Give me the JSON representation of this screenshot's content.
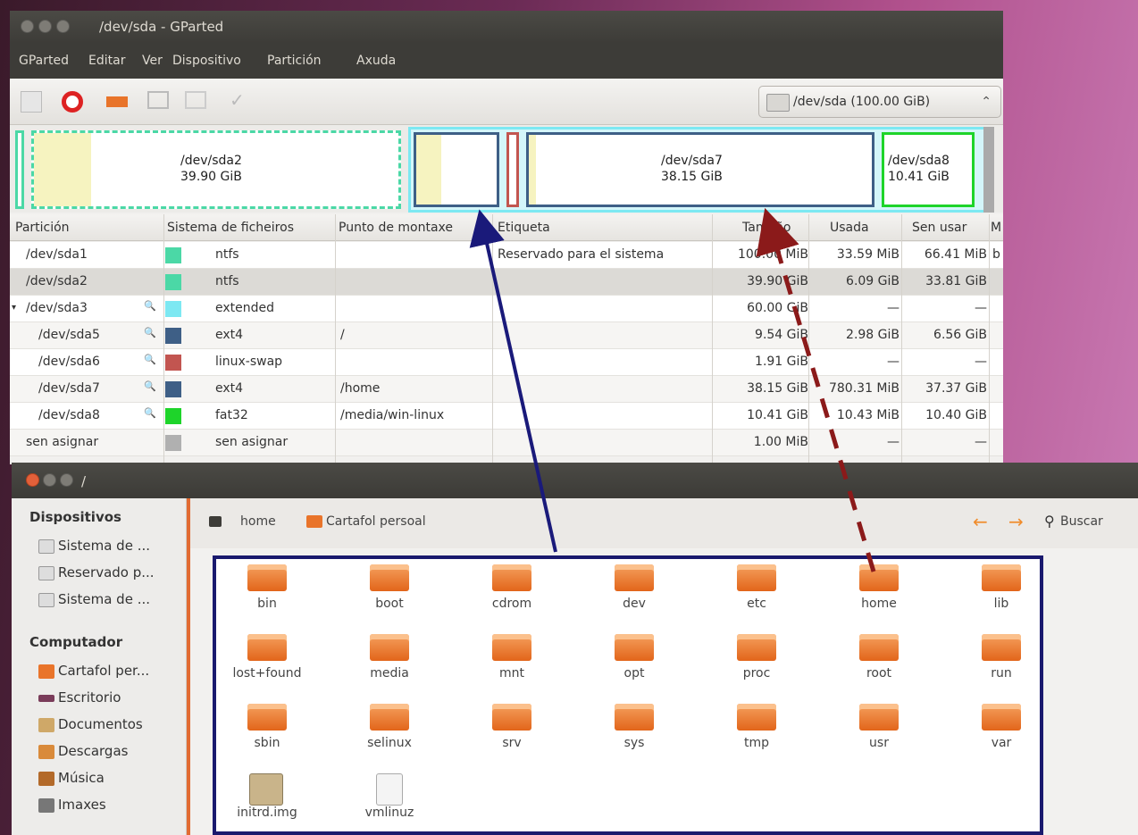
{
  "gparted": {
    "title": "/dev/sda - GParted",
    "menu": [
      "GParted",
      "Editar",
      "Ver",
      "Dispositivo",
      "Partición",
      "Axuda"
    ],
    "device_selector": "/dev/sda  (100.00 GiB)",
    "device_selector_arrow": "⌃",
    "diskmap": {
      "sda2": {
        "name": "/dev/sda2",
        "size": "39.90 GiB"
      },
      "sda7": {
        "name": "/dev/sda7",
        "size": "38.15 GiB"
      },
      "sda8": {
        "name": "/dev/sda8",
        "size": "10.41 GiB"
      }
    },
    "columns": [
      "Partición",
      "Sistema de ficheiros",
      "Punto de montaxe",
      "Etiqueta",
      "Tamaño",
      "Usada",
      "Sen usar",
      "M"
    ],
    "rows": [
      {
        "partition": "/dev/sda1",
        "fs": "ntfs",
        "color": "#4bd8a6",
        "mount": "",
        "label": "Reservado para el sistema",
        "size": "100.00 MiB",
        "used": "33.59 MiB",
        "unused": "66.41 MiB",
        "flag": "b"
      },
      {
        "partition": "/dev/sda2",
        "fs": "ntfs",
        "color": "#4bd8a6",
        "mount": "",
        "label": "",
        "size": "39.90 GiB",
        "used": "6.09 GiB",
        "unused": "33.81 GiB",
        "flag": ""
      },
      {
        "partition": "/dev/sda3",
        "fs": "extended",
        "color": "#7de8f2",
        "mount": "",
        "label": "",
        "size": "60.00 GiB",
        "used": "—",
        "unused": "—",
        "flag": ""
      },
      {
        "partition": "/dev/sda5",
        "fs": "ext4",
        "color": "#3e5f86",
        "mount": "/",
        "label": "",
        "size": "9.54 GiB",
        "used": "2.98 GiB",
        "unused": "6.56 GiB",
        "flag": ""
      },
      {
        "partition": "/dev/sda6",
        "fs": "linux-swap",
        "color": "#c25550",
        "mount": "",
        "label": "",
        "size": "1.91 GiB",
        "used": "—",
        "unused": "—",
        "flag": ""
      },
      {
        "partition": "/dev/sda7",
        "fs": "ext4",
        "color": "#3e5f86",
        "mount": "/home",
        "label": "",
        "size": "38.15 GiB",
        "used": "780.31 MiB",
        "unused": "37.37 GiB",
        "flag": ""
      },
      {
        "partition": "/dev/sda8",
        "fs": "fat32",
        "color": "#1ed42a",
        "mount": "/media/win-linux",
        "label": "",
        "size": "10.41 GiB",
        "used": "10.43 MiB",
        "unused": "10.40 GiB",
        "flag": ""
      },
      {
        "partition": "sen asignar",
        "fs": "sen asignar",
        "color": "#b0b0b0",
        "mount": "",
        "label": "",
        "size": "1.00 MiB",
        "used": "—",
        "unused": "—",
        "flag": ""
      }
    ]
  },
  "nautilus": {
    "title": "/",
    "sidebar": {
      "devices_header": "Dispositivos",
      "devices": [
        "Sistema de ...",
        "Reservado p...",
        "Sistema de ..."
      ],
      "computer_header": "Computador",
      "places": [
        {
          "label": "Cartafol per...",
          "icon": "home-folder-icon"
        },
        {
          "label": "Escritorio",
          "icon": "desktop-icon"
        },
        {
          "label": "Documentos",
          "icon": "documents-icon"
        },
        {
          "label": "Descargas",
          "icon": "downloads-icon"
        },
        {
          "label": "Música",
          "icon": "music-icon"
        },
        {
          "label": "Imaxes",
          "icon": "pictures-icon"
        }
      ]
    },
    "path": {
      "crumb1": "home",
      "crumb2": "Cartafol persoal"
    },
    "search": "Buscar",
    "files": [
      "bin",
      "boot",
      "cdrom",
      "dev",
      "etc",
      "home",
      "lib",
      "lost+found",
      "media",
      "mnt",
      "opt",
      "proc",
      "root",
      "run",
      "sbin",
      "selinux",
      "srv",
      "sys",
      "tmp",
      "usr",
      "var",
      "initrd.img",
      "vmlinuz"
    ]
  }
}
